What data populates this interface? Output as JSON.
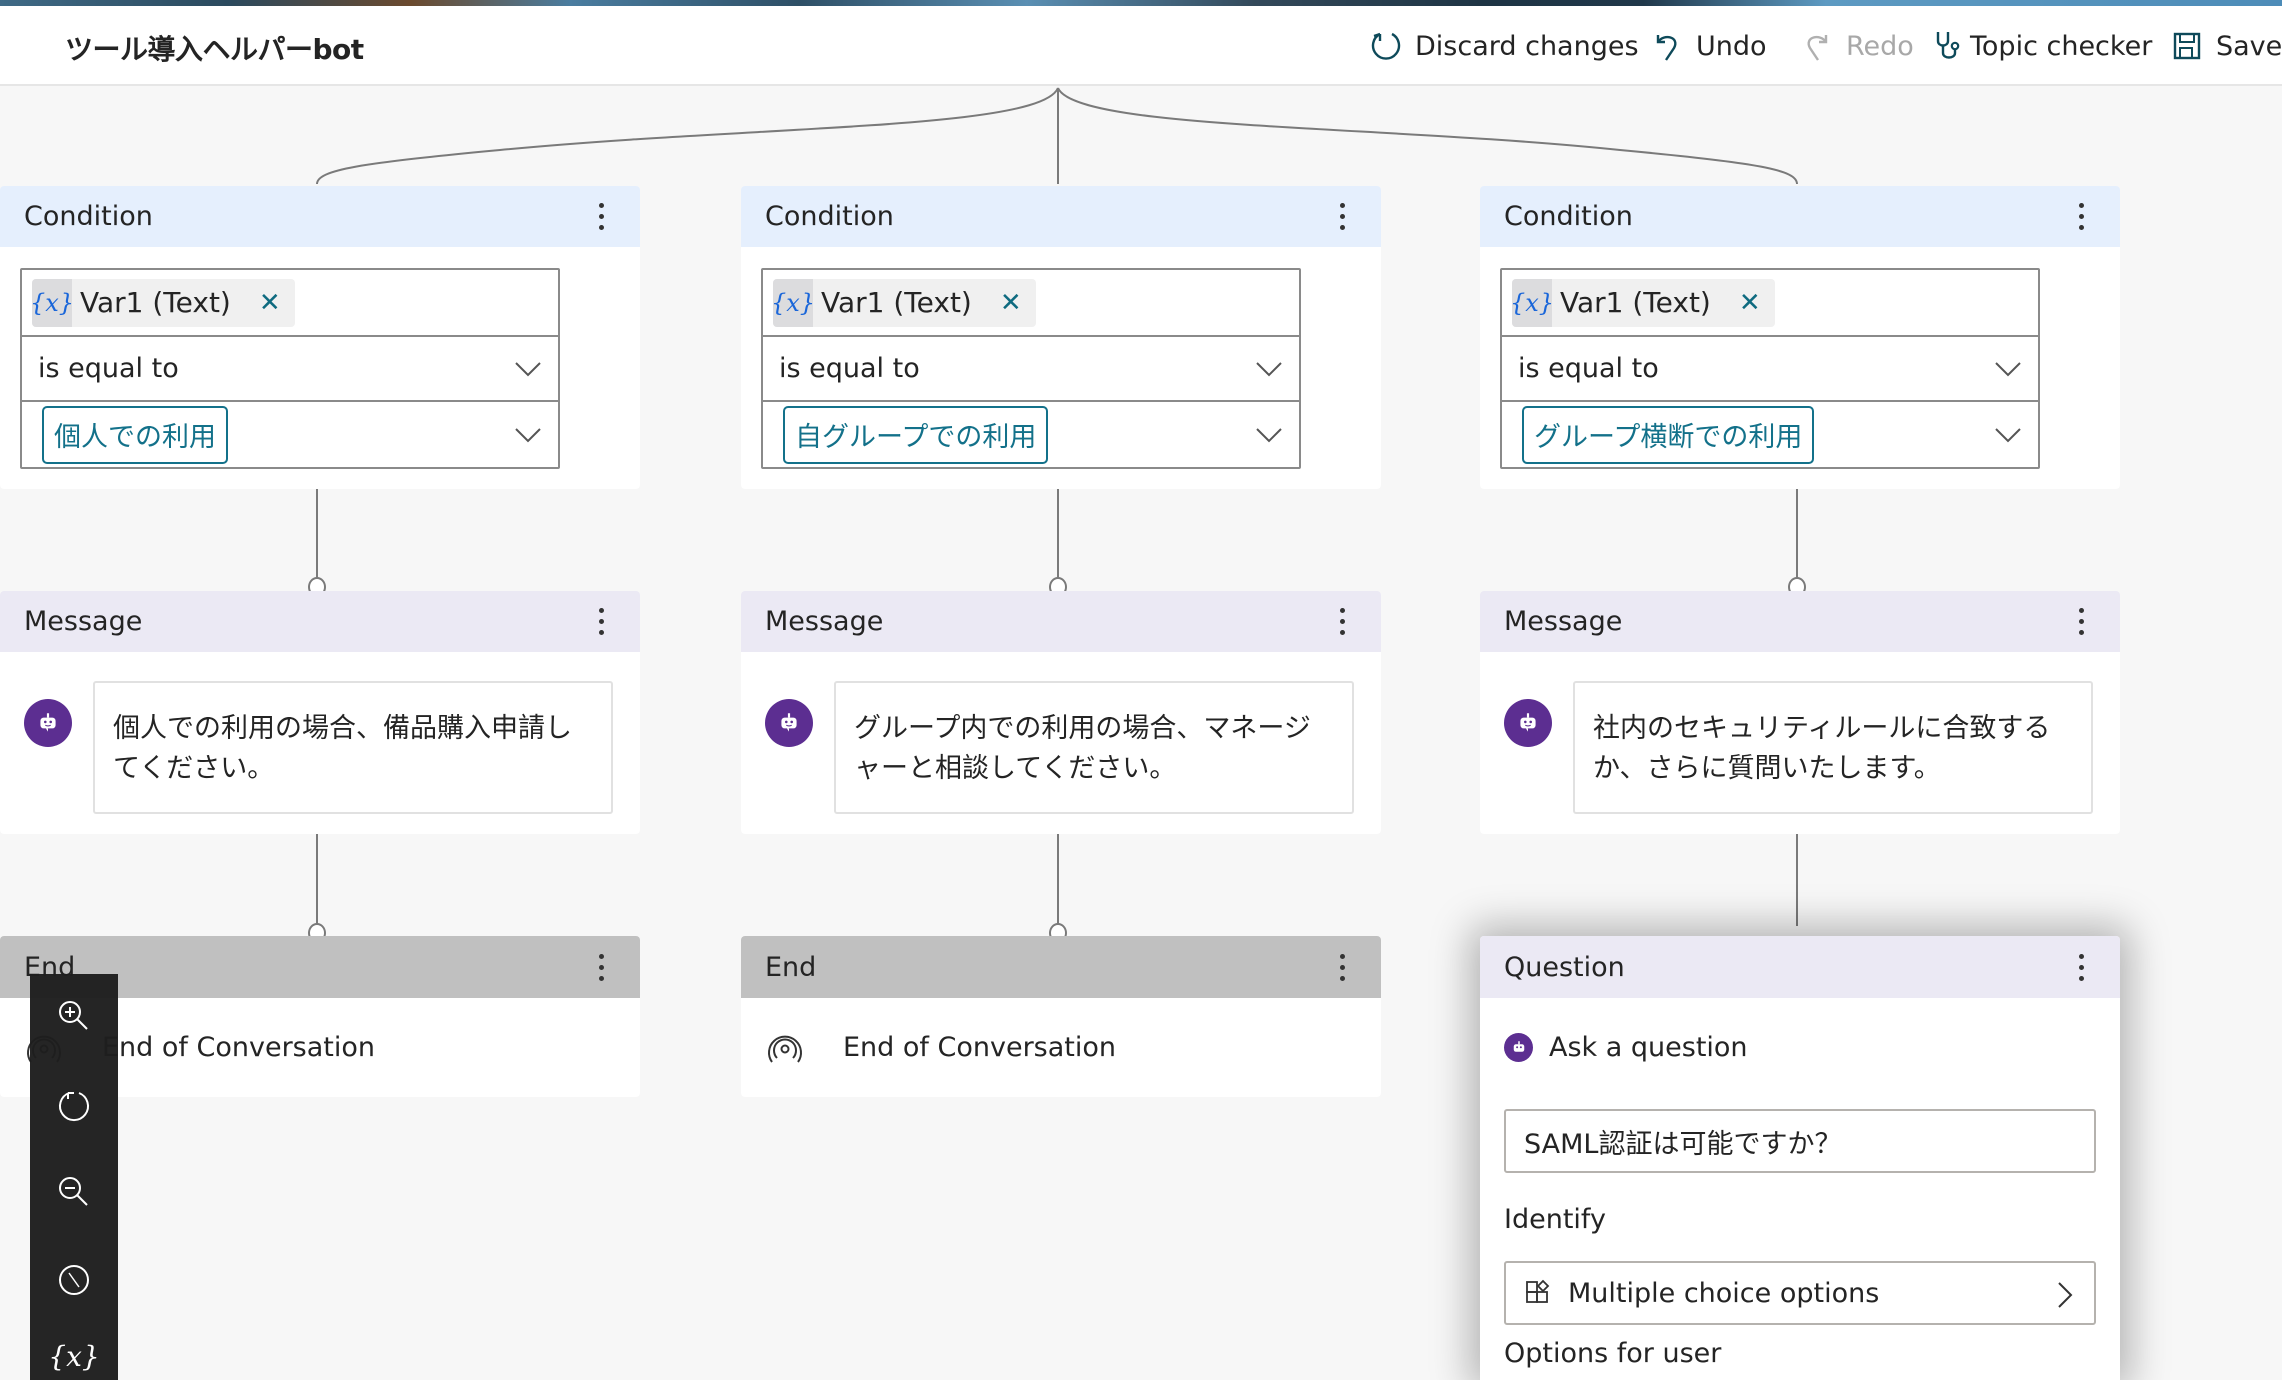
{
  "app": {
    "bot_title": "ツール導入ヘルパーbot"
  },
  "commands": {
    "discard": "Discard changes",
    "undo": "Undo",
    "redo": "Redo",
    "topic_checker": "Topic checker",
    "save": "Save"
  },
  "colors": {
    "condition_header": "#e5effd",
    "message_header": "#ebe9f4",
    "end_header": "#c0c0c0",
    "accent_teal": "#13718a",
    "bot_purple": "#5c2e91",
    "variable_blue": "#1a66d9"
  },
  "branches": [
    {
      "condition": {
        "header": "Condition",
        "variable_icon": "{x}",
        "variable": "Var1 (Text)",
        "operator": "is equal to",
        "value": "個人での利用"
      },
      "message": {
        "header": "Message",
        "text": "個人での利用の場合、備品購入申請してください。"
      },
      "end": {
        "header": "End",
        "text": "End of Conversation"
      }
    },
    {
      "condition": {
        "header": "Condition",
        "variable_icon": "{x}",
        "variable": "Var1 (Text)",
        "operator": "is equal to",
        "value": "自グループでの利用"
      },
      "message": {
        "header": "Message",
        "text": "グループ内での利用の場合、マネージャーと相談してください。"
      },
      "end": {
        "header": "End",
        "text": "End of Conversation"
      }
    },
    {
      "condition": {
        "header": "Condition",
        "variable_icon": "{x}",
        "variable": "Var1 (Text)",
        "operator": "is equal to",
        "value": "グループ横断での利用"
      },
      "message": {
        "header": "Message",
        "text": "社内のセキュリティルールに合致するか、さらに質問いたします。"
      },
      "question": {
        "header": "Question",
        "ask_label": "Ask a question",
        "question_text": "SAML認証は可能ですか？",
        "identify_label": "Identify",
        "identify_value": "Multiple choice options",
        "options_label": "Options for user"
      }
    }
  ],
  "toolbar": {
    "zoom_in": "zoom-in",
    "reset": "reset-view",
    "zoom_out": "zoom-out",
    "minimap": "navigator",
    "variables": "{x}"
  }
}
